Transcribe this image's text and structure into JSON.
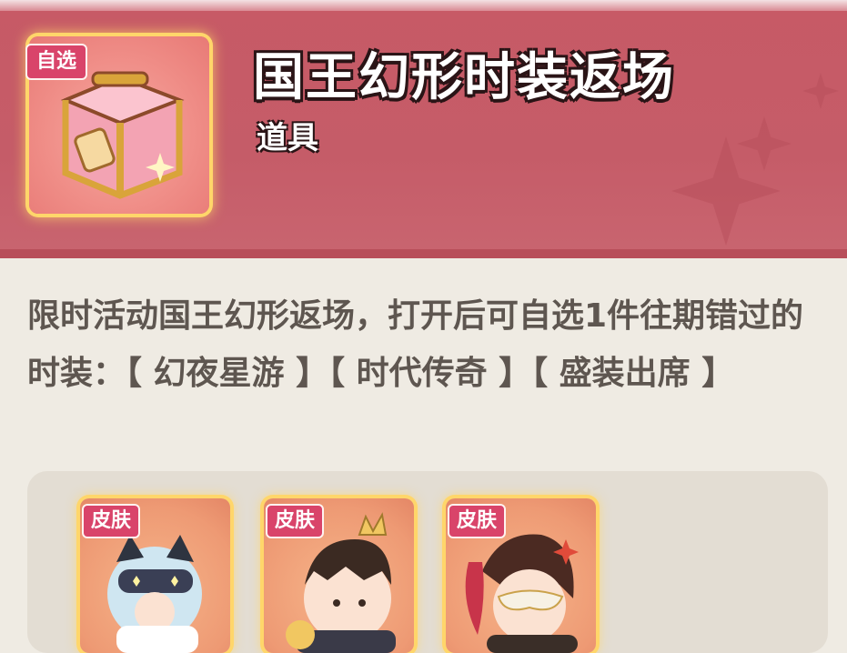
{
  "item": {
    "title": "国王幻形时装返场",
    "type_label": "道具",
    "tag": "自选",
    "icon": "treasure-chest-icon"
  },
  "description": "限时活动国王幻形返场，打开后可自选1件往期错过的时装：【 幻夜星游 】【 时代传奇 】【 盛装出席 】",
  "rewards": [
    {
      "tag": "皮肤",
      "icon": "skin-avatar-cat-mask-icon"
    },
    {
      "tag": "皮肤",
      "icon": "skin-avatar-crown-icon"
    },
    {
      "tag": "皮肤",
      "icon": "skin-avatar-masquerade-icon"
    }
  ],
  "colors": {
    "header": "#c75a66",
    "tag": "#d9446a",
    "frame_glow": "#ffd66a",
    "text": "#5e5650",
    "background": "#efebe3"
  }
}
